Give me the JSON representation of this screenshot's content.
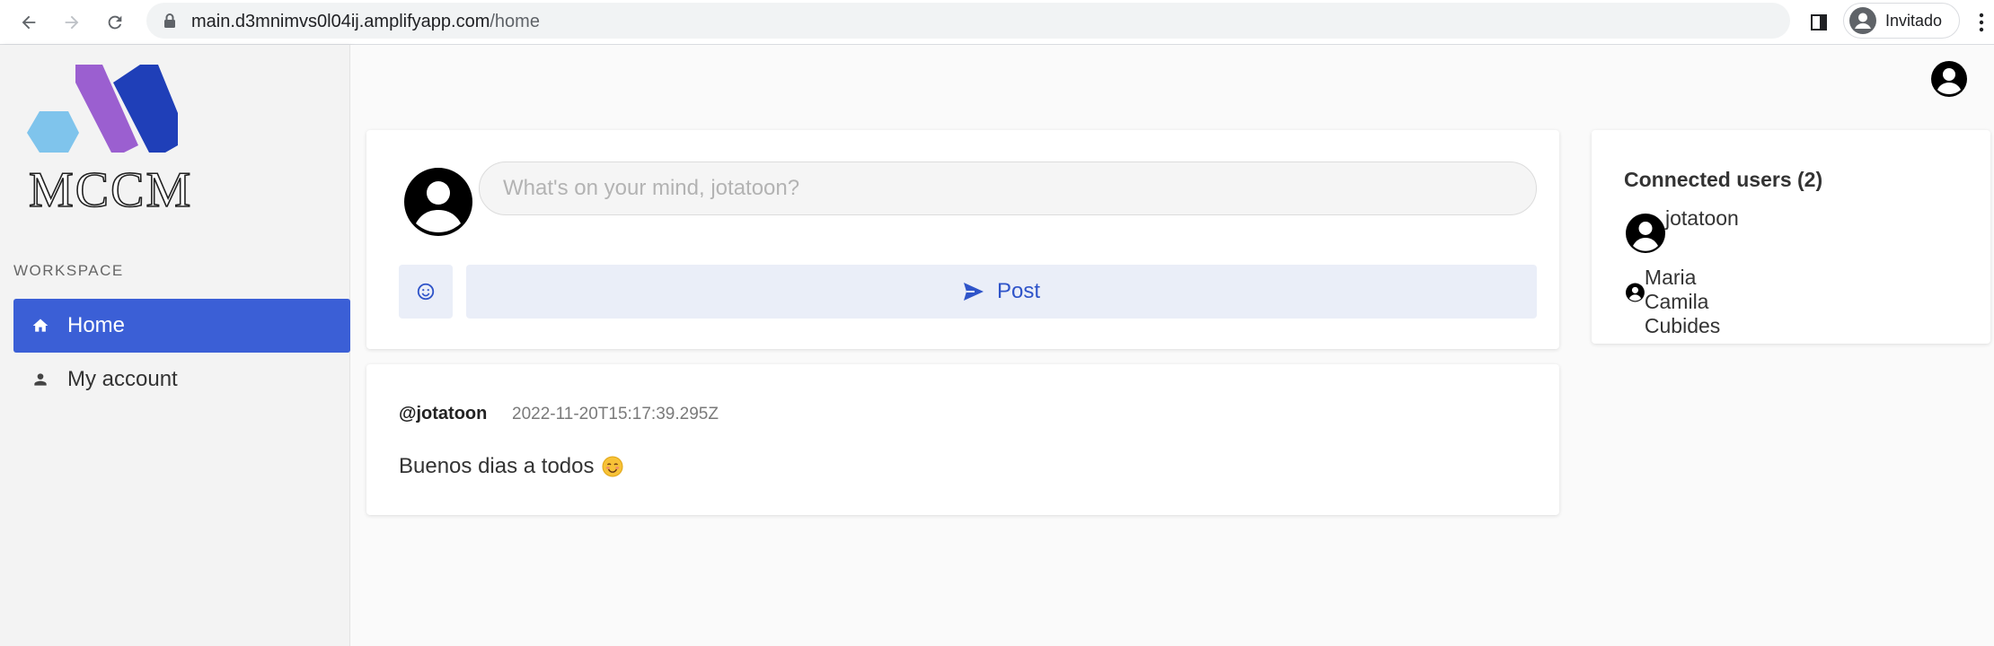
{
  "browser": {
    "url_host": "main.d3mnimvs0l04ij.amplifyapp.com",
    "url_path": "/home",
    "profile_label": "Invitado"
  },
  "sidebar": {
    "brand": "MCCM",
    "section_label": "WORKSPACE",
    "items": [
      {
        "label": "Home",
        "icon": "home-icon"
      },
      {
        "label": "My account",
        "icon": "person-icon"
      }
    ]
  },
  "composer": {
    "placeholder": "What's on your mind, jotatoon?",
    "post_label": "Post"
  },
  "feed": {
    "posts": [
      {
        "author": "@jotatoon",
        "timestamp": "2022-11-20T15:17:39.295Z",
        "content": "Buenos dias a todos"
      }
    ]
  },
  "connected": {
    "title": "Connected users (2)",
    "users": [
      "jotatoon",
      "Maria Camila Cubides"
    ]
  },
  "colors": {
    "accent": "#3b5fd6",
    "button_bg": "#eaeef8",
    "logo_purple": "#9b5fd0",
    "logo_blue": "#1f3fb8",
    "logo_light": "#7fc4ec"
  }
}
